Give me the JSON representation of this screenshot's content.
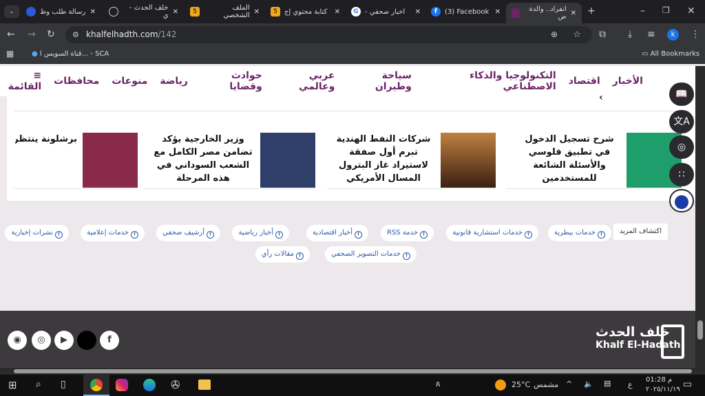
{
  "browser": {
    "tabs": [
      {
        "title": "رسالة طلب وظ",
        "active": false
      },
      {
        "title": "خلف الحدث - ي",
        "active": false
      },
      {
        "title": "الملف الشخصي",
        "active": false
      },
      {
        "title": "كتابة محتوي إج",
        "active": false
      },
      {
        "title": "اخبار صحفي - ",
        "active": false
      },
      {
        "title": "(3) Facebook",
        "active": false
      },
      {
        "title": "انفراد.. والدة ص",
        "active": true
      }
    ],
    "url_host": "khalfelhadth.com",
    "url_path": "/142",
    "bookmarks": [
      {
        "label": "قناة السويس ا... - SCA"
      }
    ],
    "all_bookmarks": "All Bookmarks",
    "profile_initial": "k"
  },
  "nav": {
    "items": [
      "الأخبار",
      "اقتصاد",
      "التكنولوجيا والذكاء الاصطناعي",
      "سياحة وطيران",
      "عربي وعالمي",
      "حوادث وقضايا",
      "رياضة",
      "منوعات",
      "محافظات"
    ],
    "menu_label": "القائمة"
  },
  "cards": [
    {
      "title": "شرح تسجيل الدخول في تطبيق فلوسي والأسئلة الشائعة للمستخدمين",
      "color": "#1e9e6a"
    },
    {
      "title": "شركات النفط الهندية تبرم أول صفقة لاستيراد غاز البترول المسال الأمريكي",
      "color": "#a0602a"
    },
    {
      "title": "وزير الخارجية يؤكد تضامن مصر الكامل مع الشعب السوداني في هذه المرحلة",
      "color": "#2f3f6a"
    },
    {
      "title": "برشلونة ينتظر مجلس المدينة لملعبه التاريخ",
      "color": "#8a2a4a"
    }
  ],
  "discover": {
    "label": "اكتشاف المزيد",
    "chips": [
      "خدمات بيطرية",
      "خدمات استشارية قانونية",
      "خدمة RSS",
      "أخبار اقتصادية",
      "أخبار رياضية",
      "أرشيف صحفي",
      "خدمات إعلامية",
      "نشرات إخبارية",
      "خدمات التصوير الصحفي",
      "مقالات رأي"
    ]
  },
  "footer": {
    "logo_ar": "خلف الحدث",
    "logo_en": "Khalf El-Hadath"
  },
  "taskbar": {
    "weather_temp": "25°C",
    "weather_desc": "مشمس",
    "time": "01:28 م",
    "date": "٢٠٢٥/١١/١٩",
    "lang": "ع"
  }
}
